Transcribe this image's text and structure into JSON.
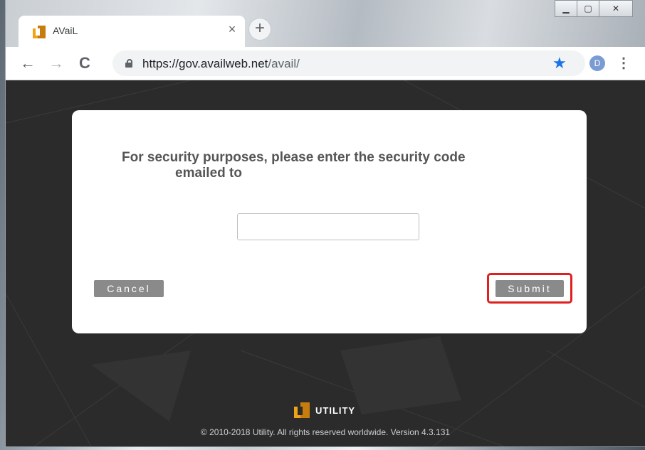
{
  "browser": {
    "tab_title": "AVaiL",
    "tab_close": "×",
    "new_tab": "+",
    "url_host": "https://gov.availweb.net",
    "url_path": "/avail/",
    "profile_initial": "D",
    "window_controls": {
      "minimize": "▁",
      "maximize": "▢",
      "close": "✕"
    },
    "nav": {
      "back": "←",
      "forward": "→",
      "reload": "C"
    },
    "star": "★",
    "menu": "⋮"
  },
  "dialog": {
    "prompt_line1": "For security purposes, please enter the security code",
    "prompt_line2": "emailed to",
    "code_value": "",
    "cancel_label": "Cancel",
    "submit_label": "Submit"
  },
  "footer": {
    "brand": "UTILITY",
    "copyright": "© 2010-2018 Utility. All rights reserved worldwide. Version 4.3.131"
  },
  "colors": {
    "highlight": "#e01f1f",
    "button": "#8a8a8a",
    "background": "#2b2b2b",
    "accent_orange": "#f0a219"
  }
}
